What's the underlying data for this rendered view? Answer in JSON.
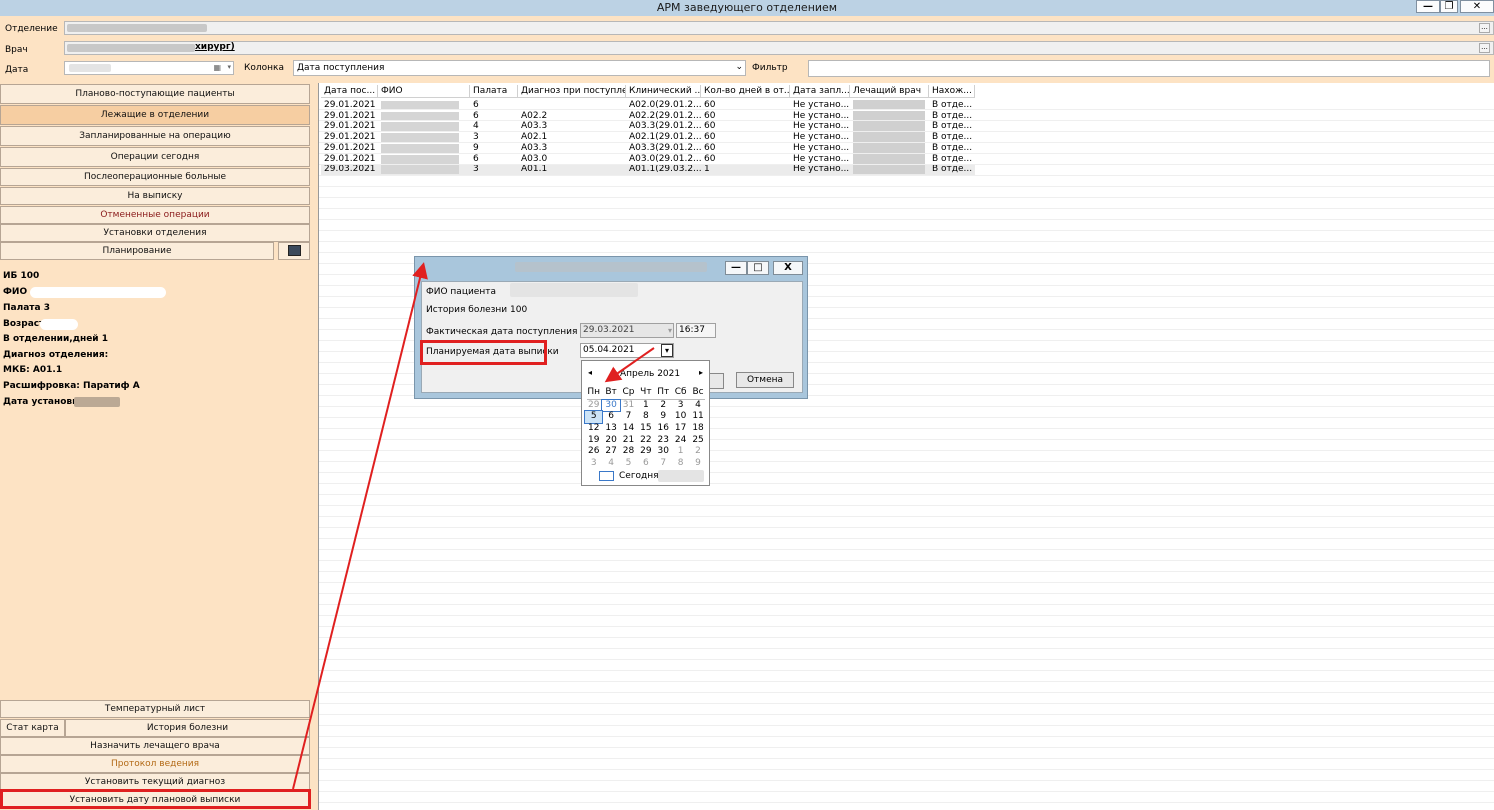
{
  "window": {
    "title": "АРМ заведующего отделением"
  },
  "filters": {
    "department_label": "Отделение",
    "doctor_label": "Врач",
    "doctor_value_suffix": "хирург)",
    "date_label": "Дата",
    "column_label": "Колонка",
    "column_value": "Дата поступления",
    "filter_label": "Фильтр",
    "ellipsis": "..."
  },
  "nav": {
    "items": [
      "Планово-поступающие пациенты",
      "Лежащие в отделении",
      "Запланированные на операцию",
      "Операции сегодня",
      "Послеоперационные больные",
      "На выписку",
      "Отмененные операции",
      "Установки отделения",
      "Планирование"
    ]
  },
  "patient_info": {
    "ib": "ИБ 100",
    "fio": "ФИО",
    "ward": "Палата 3",
    "age": "Возраст",
    "days": "В отделении,дней 1",
    "diag": "Диагноз отделения:",
    "mkb": "МКБ: А01.1",
    "decode": "Расшифровка: Паратиф А",
    "install_date": "Дата установки:"
  },
  "bottom_nav": {
    "temp": "Температурный лист",
    "stat": "Стат карта",
    "history": "История болезни",
    "assign": "Назначить лечащего врача",
    "protocol": "Протокол ведения",
    "set_diag": "Установить текущий диагноз",
    "set_discharge": "Установить дату плановой выписки"
  },
  "grid": {
    "columns": [
      "Дата пос...",
      "ФИО",
      "Палата",
      "Диагноз при поступле...",
      "Клинический ...",
      "Кол-во дней в от...",
      "Дата запл...",
      "Лечащий врач",
      "Нахож..."
    ],
    "rows": [
      {
        "date": "29.01.2021",
        "ward": "6",
        "diag_in": "",
        "clin": "A02.0(29.01.2...",
        "days": "60",
        "plan": "Не устано...",
        "loc": "В отде..."
      },
      {
        "date": "29.01.2021",
        "ward": "6",
        "diag_in": "A02.2",
        "clin": "A02.2(29.01.2...",
        "days": "60",
        "plan": "Не устано...",
        "loc": "В отде..."
      },
      {
        "date": "29.01.2021",
        "ward": "4",
        "diag_in": "A03.3",
        "clin": "A03.3(29.01.2...",
        "days": "60",
        "plan": "Не устано...",
        "loc": "В отде..."
      },
      {
        "date": "29.01.2021",
        "ward": "3",
        "diag_in": "A02.1",
        "clin": "A02.1(29.01.2...",
        "days": "60",
        "plan": "Не устано...",
        "loc": "В отде..."
      },
      {
        "date": "29.01.2021",
        "ward": "9",
        "diag_in": "A03.3",
        "clin": "A03.3(29.01.2...",
        "days": "60",
        "plan": "Не устано...",
        "loc": "В отде..."
      },
      {
        "date": "29.01.2021",
        "ward": "6",
        "diag_in": "A03.0",
        "clin": "A03.0(29.01.2...",
        "days": "60",
        "plan": "Не устано...",
        "loc": "В отде..."
      },
      {
        "date": "29.03.2021",
        "ward": "3",
        "diag_in": "A01.1",
        "clin": "A01.1(29.03.2...",
        "days": "1",
        "plan": "Не устано...",
        "loc": "В отде..."
      }
    ]
  },
  "dialog": {
    "fio_label": "ФИО пациента",
    "history_label": "История болезни",
    "history_value": "100",
    "actual_label": "Фактическая дата поступления",
    "actual_date": "29.03.2021",
    "actual_time": "16:37",
    "planned_label": "Планируемая дата выписки",
    "planned_date": "05.04.2021",
    "cancel": "Отмена",
    "minimize": "—",
    "maximize": "□",
    "close": "X"
  },
  "calendar": {
    "month": "Апрель 2021",
    "weekdays": [
      "Пн",
      "Вт",
      "Ср",
      "Чт",
      "Пт",
      "Сб",
      "Вс"
    ],
    "weeks": [
      [
        "29",
        "30",
        "31",
        "1",
        "2",
        "3",
        "4"
      ],
      [
        "5",
        "6",
        "7",
        "8",
        "9",
        "10",
        "11"
      ],
      [
        "12",
        "13",
        "14",
        "15",
        "16",
        "17",
        "18"
      ],
      [
        "19",
        "20",
        "21",
        "22",
        "23",
        "24",
        "25"
      ],
      [
        "26",
        "27",
        "28",
        "29",
        "30",
        "1",
        "2"
      ],
      [
        "3",
        "4",
        "5",
        "6",
        "7",
        "8",
        "9"
      ]
    ],
    "today_label": "Сегодня:"
  },
  "colors": {
    "highlight": "#e02020",
    "accent": "#3a78c8"
  }
}
